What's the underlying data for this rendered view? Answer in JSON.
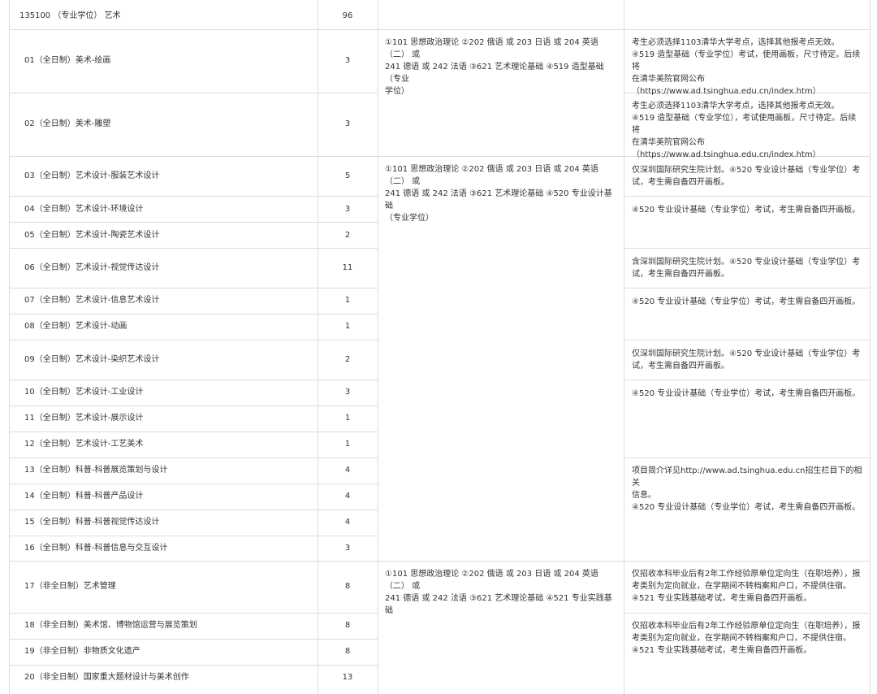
{
  "header": {
    "code_name": "135100 （专业学位） 艺术",
    "total": "96"
  },
  "rows": [
    {
      "name": "01（全日制）美术-绘画",
      "count": "3"
    },
    {
      "name": "02（全日制）美术-雕塑",
      "count": "3"
    },
    {
      "name": "03（全日制）艺术设计-服装艺术设计",
      "count": "5"
    },
    {
      "name": "04（全日制）艺术设计-环境设计",
      "count": "3"
    },
    {
      "name": "05（全日制）艺术设计-陶瓷艺术设计",
      "count": "2"
    },
    {
      "name": "06（全日制）艺术设计-视觉传达设计",
      "count": "11"
    },
    {
      "name": "07（全日制）艺术设计-信息艺术设计",
      "count": "1"
    },
    {
      "name": "08（全日制）艺术设计-动画",
      "count": "1"
    },
    {
      "name": "09（全日制）艺术设计-染织艺术设计",
      "count": "2"
    },
    {
      "name": "10（全日制）艺术设计-工业设计",
      "count": "3"
    },
    {
      "name": "11（全日制）艺术设计-展示设计",
      "count": "1"
    },
    {
      "name": "12（全日制）艺术设计-工艺美术",
      "count": "1"
    },
    {
      "name": "13（全日制）科普-科普展览策划与设计",
      "count": "4"
    },
    {
      "name": "14（全日制）科普-科普产品设计",
      "count": "4"
    },
    {
      "name": "15（全日制）科普-科普视觉传达设计",
      "count": "4"
    },
    {
      "name": "16（全日制）科普-科普信息与交互设计",
      "count": "3"
    },
    {
      "name": "17（非全日制）艺术管理",
      "count": "8"
    },
    {
      "name": "18（非全日制）美术馆、博物馆运营与展览策划",
      "count": "8"
    },
    {
      "name": "19（非全日制）非物质文化遗产",
      "count": "8"
    },
    {
      "name": "20（非全日制）国家重大题材设计与美术创作",
      "count": "13"
    }
  ],
  "subjects": {
    "s1": [
      "①101 思想政治理论 ②202 俄语 或 203 日语 或 204 英语（二） 或",
      "241 德语 或 242 法语 ③621 艺术理论基础 ④519 造型基础（专业",
      "学位）"
    ],
    "s2": [
      "①101 思想政治理论 ②202 俄语 或 203 日语 或 204 英语（二） 或",
      "241 德语 或 242 法语 ③621 艺术理论基础 ④520 专业设计基础",
      "（专业学位）"
    ],
    "s3": [
      "①101 思想政治理论 ②202 俄语 或 203 日语 或 204 英语（二） 或",
      "241 德语 或 242 法语 ③621 艺术理论基础 ④521 专业实践基础"
    ]
  },
  "notes": {
    "n1": [
      "考生必须选择1103清华大学考点，选择其他报考点无效。",
      "④519 造型基础（专业学位）考试，使用画板，尺寸待定。后续将",
      "在清华美院官网公布",
      "（https://www.ad.tsinghua.edu.cn/index.htm）"
    ],
    "n2": [
      "考生必须选择1103清华大学考点，选择其他报考点无效。",
      "④519 造型基础（专业学位），考试使用画板，尺寸待定。后续将",
      "在清华美院官网公布",
      "（https://www.ad.tsinghua.edu.cn/index.htm）"
    ],
    "n3": [
      "仅深圳国际研究生院计划。④520 专业设计基础（专业学位）考",
      "试，考生需自备四开画板。"
    ],
    "n4": [
      "④520 专业设计基础（专业学位）考试，考生需自备四开画板。"
    ],
    "n5": [
      "含深圳国际研究生院计划。④520 专业设计基础（专业学位）考",
      "试，考生需自备四开画板。"
    ],
    "n6": [
      "④520 专业设计基础（专业学位）考试，考生需自备四开画板。"
    ],
    "n7": [
      "仅深圳国际研究生院计划。④520 专业设计基础（专业学位）考",
      "试，考生需自备四开画板。"
    ],
    "n8": [
      "④520 专业设计基础（专业学位）考试，考生需自备四开画板。"
    ],
    "n9": [
      "项目简介详见http://www.ad.tsinghua.edu.cn招生栏目下的相关",
      "信息。",
      "④520 专业设计基础（专业学位）考试，考生需自备四开画板。"
    ],
    "n10": [
      "仅招收本科毕业后有2年工作经验原单位定向生（在职培养），报",
      "考类别为定向就业，在学期间不转档案和户口，不提供住宿。",
      " ④521 专业实践基础考试，考生需自备四开画板。"
    ],
    "n11": [
      "仅招收本科毕业后有2年工作经验原单位定向生（在职培养），报",
      "考类别为定向就业，在学期间不转档案和户口，不提供住宿。",
      "④521 专业实践基础考试，考生需自备四开画板。"
    ]
  }
}
